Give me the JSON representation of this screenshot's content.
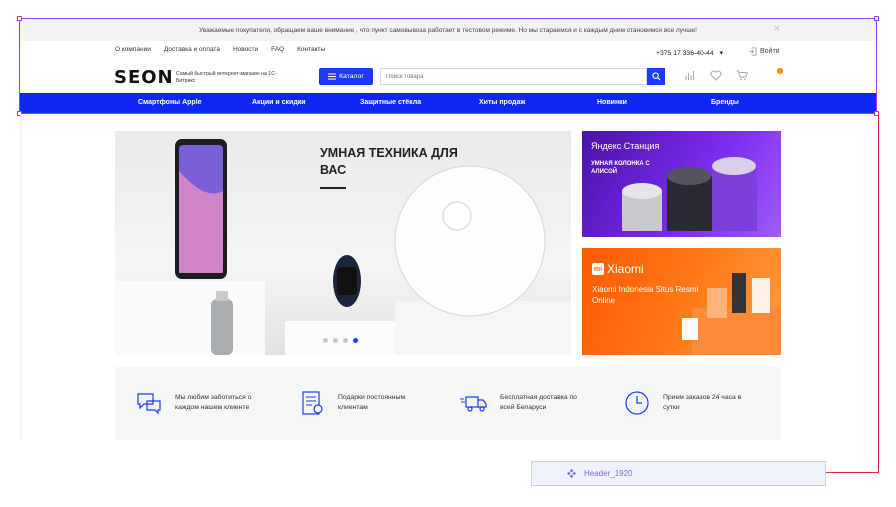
{
  "notice": {
    "text": "Уважаемые покупатели, обращаем ваше внимание , что пункт самовывоза работает в тестовом режиме. Но мы стараемся и с каждым днем становимся все лучше!",
    "close": "×"
  },
  "topnav": {
    "items": [
      {
        "label": "О компании"
      },
      {
        "label": "Доставка и оплата"
      },
      {
        "label": "Новости"
      },
      {
        "label": "FAQ"
      },
      {
        "label": "Контакты"
      }
    ],
    "phone": "+375 17 336-40-44",
    "login": "Войти"
  },
  "header": {
    "logo": "SEON",
    "tagline": "Самый быстрый интернет-магазин на 1С-Битрикс",
    "catalog": "Каталог",
    "search_placeholder": "Поиск товара",
    "cart_count": "2"
  },
  "mainnav": {
    "items": [
      {
        "label": "Смартфоны Apple"
      },
      {
        "label": "Акции и скидки"
      },
      {
        "label": "Защитные стёкла"
      },
      {
        "label": "Хиты продаж"
      },
      {
        "label": "Новинки"
      },
      {
        "label": "Бренды"
      }
    ]
  },
  "hero": {
    "title": "УМНАЯ ТЕХНИКА ДЛЯ ВАС",
    "slides": 4,
    "active_slide": 4
  },
  "banners": [
    {
      "brand": "Яндекс Станция",
      "subtitle": "УМНАЯ КОЛОНКА С АЛИСОЙ"
    },
    {
      "brand": "Xiaomi",
      "logo": "mi",
      "subtitle": "Xiaomi Indonesia Situs Resmi Online"
    }
  ],
  "features": [
    {
      "icon": "chat-support-icon",
      "text": "Мы любим заботиться о каждом нашем клиенте"
    },
    {
      "icon": "gift-card-icon",
      "text": "Подарки постоянным клиентам"
    },
    {
      "icon": "delivery-truck-icon",
      "text": "Бесплатная доставка по всей Беларуси"
    },
    {
      "icon": "clock-icon",
      "text": "Прием заказов 24 часа в сутки"
    }
  ],
  "component_label": "Header_1920",
  "colors": {
    "accent": "#1b3cf2",
    "nav_bg": "#0f27f5",
    "selection": "#9b3fd1",
    "connector": "#d42a3a"
  }
}
